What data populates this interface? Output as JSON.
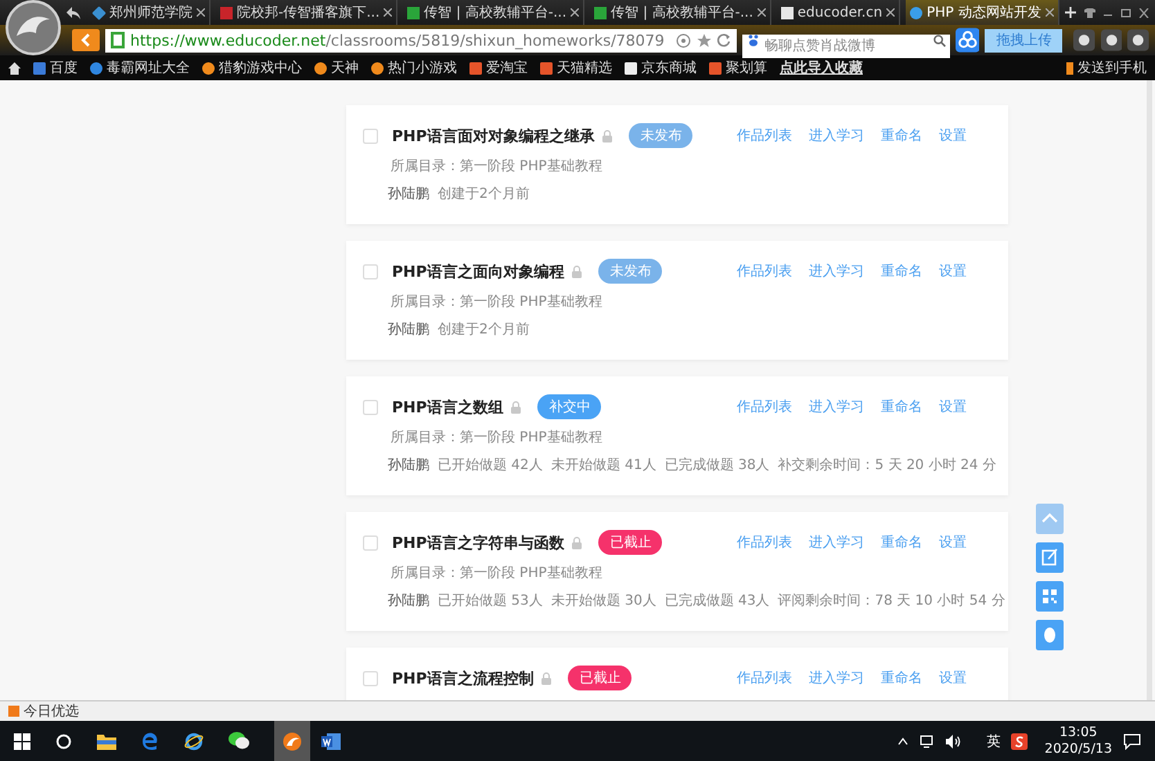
{
  "browser": {
    "tabs": [
      {
        "label": "郑州师范学院",
        "kind": "diamond",
        "selected": false
      },
      {
        "label": "院校邦-传智播客旗下...",
        "kind": "red",
        "selected": false
      },
      {
        "label": "传智 | 高校教辅平台-...",
        "kind": "leaf",
        "selected": false
      },
      {
        "label": "传智 | 高校教辅平台-...",
        "kind": "leaf",
        "selected": false
      },
      {
        "label": "educoder.cn",
        "kind": "page",
        "selected": false
      },
      {
        "label": "PHP 动态网站开发",
        "kind": "round",
        "selected": true
      }
    ],
    "url_host": "https://www.educoder.net",
    "url_path": "/classrooms/5819/shixun_homeworks/78079",
    "search_placeholder": "畅聊点赞肖战微博",
    "upload_button": "拖拽上传",
    "bookmarks": [
      {
        "label": "百度",
        "kind": "blue"
      },
      {
        "label": "毒霸网址大全",
        "kind": "round"
      },
      {
        "label": "猎豹游戏中心",
        "kind": "orange"
      },
      {
        "label": "天神",
        "kind": "orange"
      },
      {
        "label": "热门小游戏",
        "kind": "orange"
      },
      {
        "label": "爱淘宝",
        "kind": "red"
      },
      {
        "label": "天猫精选",
        "kind": "red"
      },
      {
        "label": "京东商城",
        "kind": "page"
      },
      {
        "label": "聚划算",
        "kind": "red"
      }
    ],
    "import_bookmarks": "点此导入收藏",
    "send_to_phone": "发送到手机"
  },
  "homeworks": [
    {
      "title": "PHP语言面对对象编程之继承",
      "checked": false,
      "status": {
        "label": "未发布",
        "kind": "unpublished"
      },
      "actions": [
        "作品列表",
        "进入学习",
        "重命名",
        "设置"
      ],
      "directory": "所属目录：第一阶段 PHP基础教程",
      "author": "孙陆鹏",
      "details": [
        "创建于2个月前"
      ]
    },
    {
      "title": "PHP语言之面向对象编程",
      "checked": false,
      "status": {
        "label": "未发布",
        "kind": "unpublished"
      },
      "actions": [
        "作品列表",
        "进入学习",
        "重命名",
        "设置"
      ],
      "directory": "所属目录：第一阶段 PHP基础教程",
      "author": "孙陆鹏",
      "details": [
        "创建于2个月前"
      ]
    },
    {
      "title": "PHP语言之数组",
      "checked": false,
      "status": {
        "label": "补交中",
        "kind": "active"
      },
      "actions": [
        "作品列表",
        "进入学习",
        "重命名",
        "设置"
      ],
      "directory": "所属目录：第一阶段 PHP基础教程",
      "author": "孙陆鹏",
      "details": [
        "已开始做题 42人",
        "未开始做题 41人",
        "已完成做题 38人",
        "补交剩余时间：5 天 20 小时 24 分"
      ]
    },
    {
      "title": "PHP语言之字符串与函数",
      "checked": false,
      "status": {
        "label": "已截止",
        "kind": "ended"
      },
      "actions": [
        "作品列表",
        "进入学习",
        "重命名",
        "设置"
      ],
      "directory": "所属目录：第一阶段 PHP基础教程",
      "author": "孙陆鹏",
      "details": [
        "已开始做题 53人",
        "未开始做题 30人",
        "已完成做题 43人",
        "评阅剩余时间：78 天 10 小时 54 分"
      ]
    },
    {
      "title": "PHP语言之流程控制",
      "checked": false,
      "status": {
        "label": "已截止",
        "kind": "ended"
      },
      "actions": [
        "作品列表",
        "进入学习",
        "重命名",
        "设置"
      ]
    }
  ],
  "status_bar": {
    "label": "今日优选"
  },
  "taskbar": {
    "ime": "英",
    "time": "13:05",
    "date": "2020/5/13"
  }
}
